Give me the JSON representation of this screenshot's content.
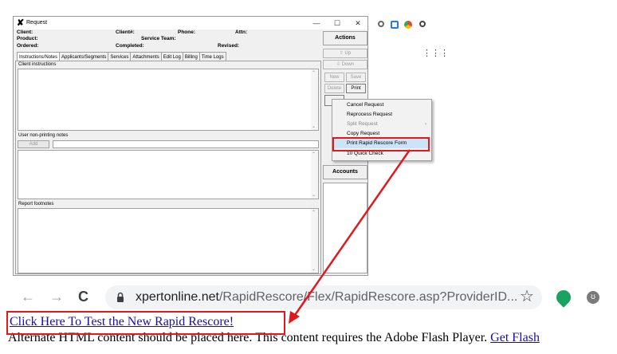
{
  "window": {
    "title": "Request",
    "minimize": "—",
    "maximize": "☐",
    "close": "✕"
  },
  "header": {
    "client": "Client:",
    "client_no": "Client#:",
    "phone": "Phone:",
    "attn": "Attn:",
    "product": "Product:",
    "service_team": "Service Team:",
    "ordered": "Ordered:",
    "completed": "Completed:",
    "revised": "Revised:"
  },
  "tabs": [
    "Instructions/Notes",
    "Applicants/Segments",
    "Services",
    "Attachments",
    "Edit Log",
    "Billing",
    "Time Logs"
  ],
  "sections": {
    "client_instructions": "Client instructions",
    "user_notes": "User non-printing notes",
    "add": "Add",
    "report_footnotes": "Report footnotes"
  },
  "actions": {
    "heading": "Actions",
    "up": "Up",
    "down": "Down",
    "new": "New",
    "save": "Save",
    "delete": "Delete",
    "print": "Print",
    "accounts": "Accounts"
  },
  "context_menu": {
    "items": [
      "Cancel Request",
      "Reprocess Request",
      "Split Request",
      "Copy Request",
      "Print Rapid Rescore Form",
      "10 Quick Check"
    ]
  },
  "browser": {
    "back": "←",
    "forward": "→",
    "reload": "C",
    "url_domain": "xpertonline.net",
    "url_path": "/RapidRescore/Flex/RapidRescore.asp?ProviderID...",
    "star": "☆",
    "profile": "ʊ"
  },
  "page": {
    "link_text": "Click Here To Test the New Rapid Rescore!",
    "alt_text": "Alternate HTML content should be placed here. This content requires the Adobe Flash Player.",
    "flash_link": "Get Flash"
  },
  "colors": {
    "annotation_red": "#e2191c",
    "link_blue": "#1a0dab",
    "menu_highlight": "#cce4f7"
  }
}
